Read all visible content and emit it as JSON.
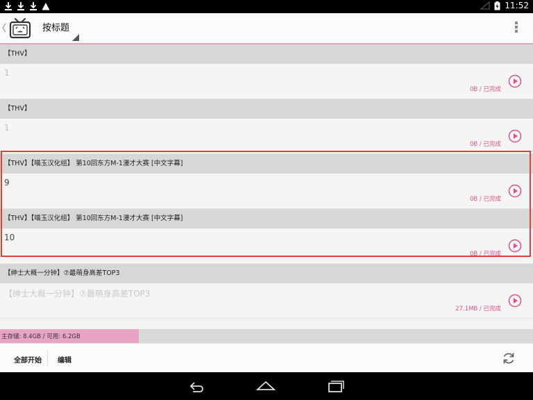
{
  "status_bar": {
    "time": "11:52",
    "icons": [
      "download-icon",
      "download-icon",
      "download-icon",
      "warning-icon",
      "signal-icon",
      "battery-icon"
    ]
  },
  "app_bar": {
    "sort_label": "按标题",
    "logo_icon": "bilibili-tv-icon",
    "overflow_icon": "more-vert-icon"
  },
  "items": [
    {
      "header": "【THV】",
      "body_number": "1",
      "body_title": "",
      "status": "0B / 已完成"
    },
    {
      "header": "【THV】",
      "body_number": "1",
      "body_title": "",
      "status": "0B / 已完成"
    },
    {
      "header": "【THV】【喵玉汉化组】 第10回东方M-1漫才大赛 [中文字幕]",
      "body_number": "9",
      "body_title": "",
      "status": "0B / 已完成"
    },
    {
      "header": "【THV】【喵玉汉化组】 第10回东方M-1漫才大赛 [中文字幕]",
      "body_number": "10",
      "body_title": "",
      "status": "0B / 已完成"
    },
    {
      "header": "【绅士大概一分钟】⑦最萌身高差TOP3",
      "body_number": "",
      "body_title": "【绅士大概一分钟】⑦最萌身高差TOP3",
      "status": "27.1MB / 已完成"
    }
  ],
  "storage": {
    "text": "主存储: 8.4GB / 可用: 6.2GB",
    "used_fraction": 0.26
  },
  "toolbar": {
    "start_all": "全部开始",
    "edit": "编辑"
  },
  "colors": {
    "accent": "#e0508a",
    "highlight": "#ea3b3b",
    "storage_fill": "#e9a3c3"
  }
}
